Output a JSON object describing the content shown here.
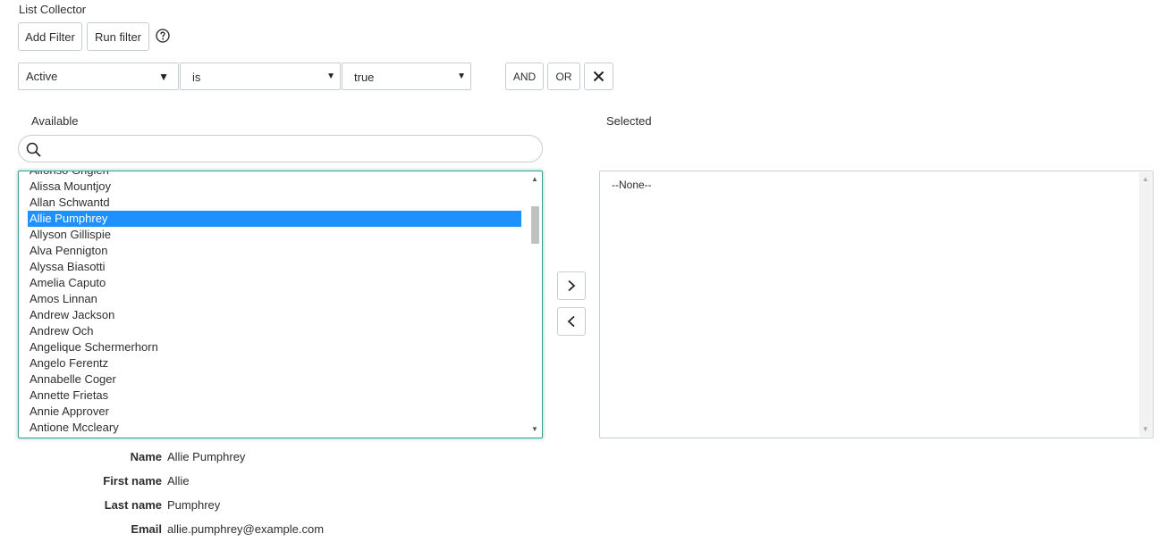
{
  "title": "List Collector",
  "toolbar": {
    "add_filter_label": "Add Filter",
    "run_filter_label": "Run filter",
    "help_icon": "question-circle-icon"
  },
  "filter": {
    "field": "Active",
    "operator": "is",
    "value": "true",
    "and_label": "AND",
    "or_label": "OR",
    "remove_icon": "close-icon"
  },
  "available": {
    "label": "Available",
    "search_placeholder": "",
    "items": [
      "Alfonso Griglen",
      "Alissa Mountjoy",
      "Allan Schwantd",
      "Allie Pumphrey",
      "Allyson Gillispie",
      "Alva Pennigton",
      "Alyssa Biasotti",
      "Amelia Caputo",
      "Amos Linnan",
      "Andrew Jackson",
      "Andrew Och",
      "Angelique Schermerhorn",
      "Angelo Ferentz",
      "Annabelle Coger",
      "Annette Frietas",
      "Annie Approver",
      "Antione Mccleary"
    ],
    "selected_item": "Allie Pumphrey"
  },
  "selected": {
    "label": "Selected",
    "items": [
      "--None--"
    ]
  },
  "move_buttons": {
    "add_icon": "chevron-right-icon",
    "remove_icon": "chevron-left-icon"
  },
  "details": {
    "name_label": "Name",
    "name_value": "Allie Pumphrey",
    "first_name_label": "First name",
    "first_name_value": "Allie",
    "last_name_label": "Last name",
    "last_name_value": "Pumphrey",
    "email_label": "Email",
    "email_value": "allie.pumphrey@example.com"
  },
  "colors": {
    "highlight": "#1e90ff",
    "focus_border": "#3b9f93",
    "border": "#c8cdd1"
  }
}
